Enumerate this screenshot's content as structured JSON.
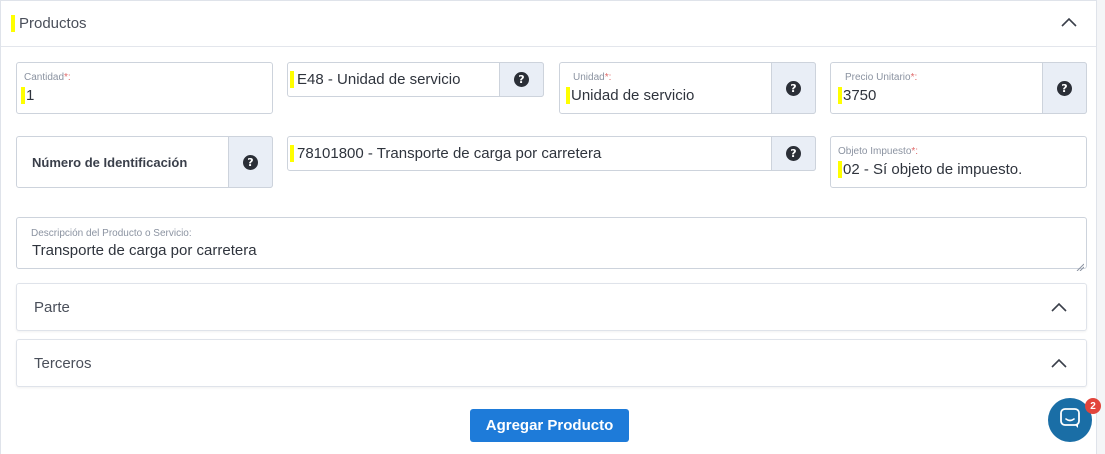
{
  "section": {
    "title": "Productos"
  },
  "fields": {
    "cantidad": {
      "label": "Cantidad",
      "required": "*:",
      "value": "1"
    },
    "clave_unidad": {
      "value": "E48 - Unidad de servicio"
    },
    "unidad": {
      "label": "Unidad",
      "required": "*:",
      "value": "Unidad de servicio"
    },
    "precio": {
      "label": "Precio Unitario",
      "required": "*:",
      "value": "3750"
    },
    "numero_id": {
      "label": "Número de Identificación"
    },
    "clave_producto": {
      "value": "78101800 - Transporte de carga por carretera"
    },
    "objeto_impuesto": {
      "label": "Objeto Impuesto",
      "required": "*:",
      "value": "02 - Sí objeto de impuesto."
    },
    "descripcion": {
      "label": "Descripción del Producto o Servicio:",
      "value": "Transporte de carga por carretera"
    }
  },
  "help_glyph": "?",
  "collapsibles": [
    {
      "title": "Parte"
    },
    {
      "title": "Terceros"
    }
  ],
  "add_button": {
    "label": "Agregar Producto"
  },
  "chat": {
    "badge": "2"
  },
  "colors": {
    "primary": "#1e7bd9",
    "highlight": "#ffff00",
    "chat": "#1a6ea6",
    "badge": "#e2453c"
  },
  "icons": {
    "collapse": "chevron-up-icon",
    "help": "question-circle-icon",
    "chat": "chat-bubble-icon"
  }
}
